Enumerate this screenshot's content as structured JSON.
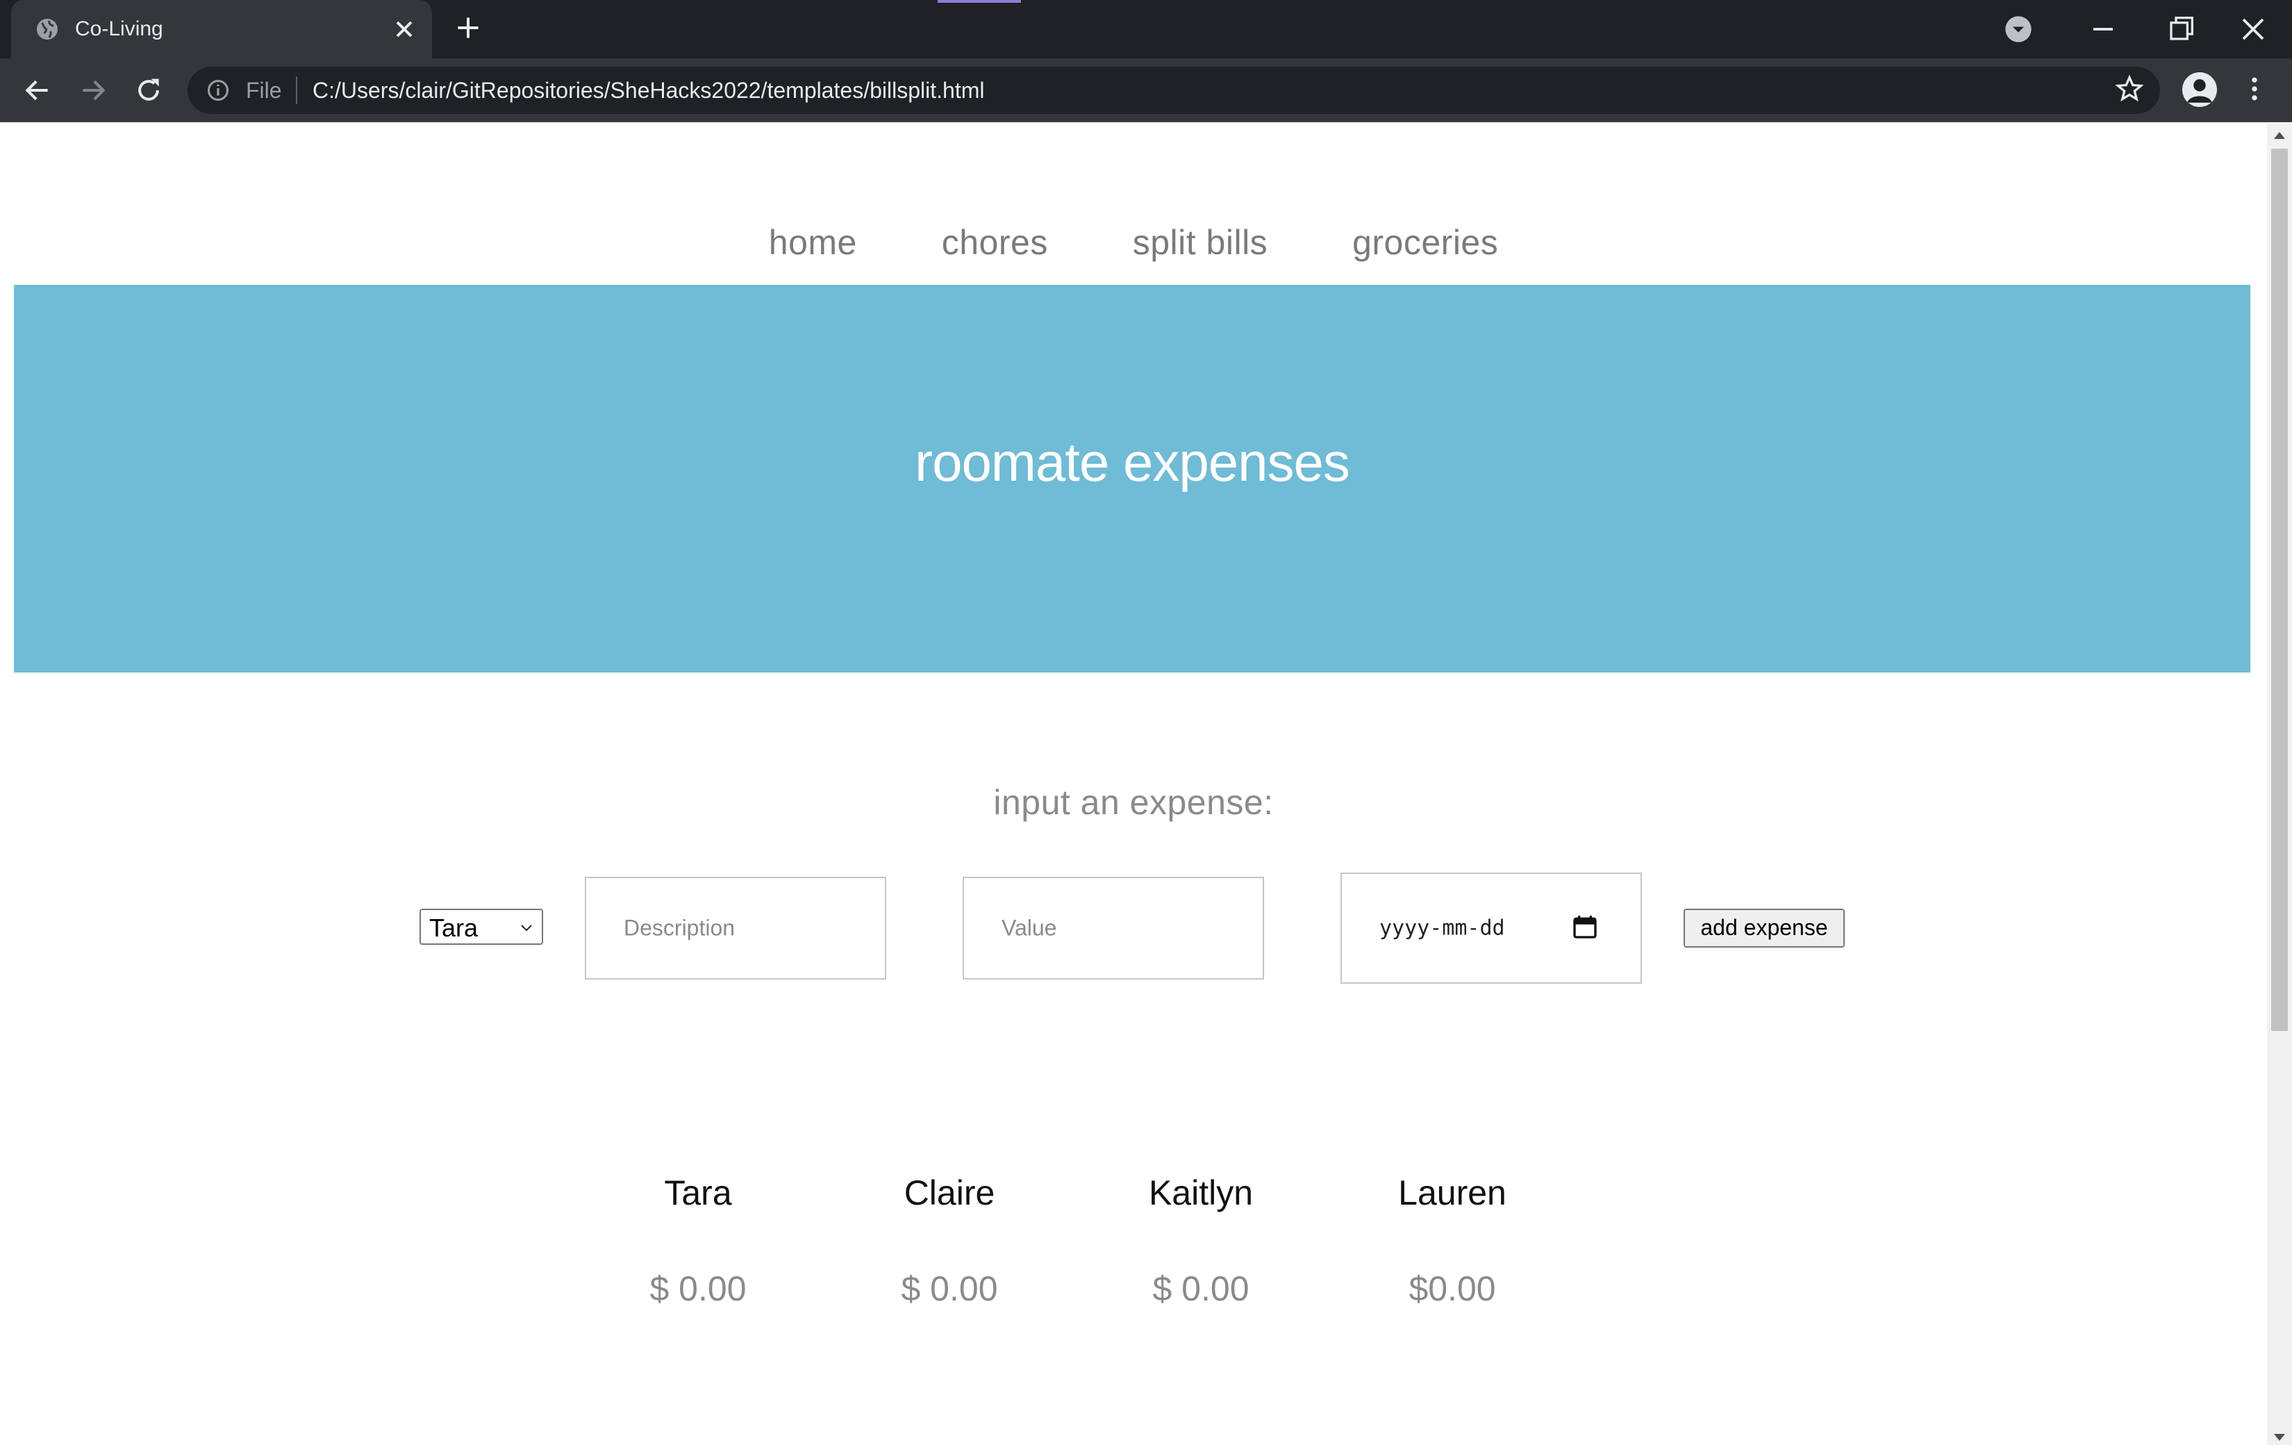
{
  "browser": {
    "tab_title": "Co-Living",
    "url_scheme": "File",
    "url": "C:/Users/clair/GitRepositories/SheHacks2022/templates/billsplit.html"
  },
  "nav": {
    "items": [
      "home",
      "chores",
      "split bills",
      "groceries"
    ]
  },
  "hero": {
    "title": "roomate expenses",
    "background_color": "#70bbd5"
  },
  "expense_form": {
    "heading": "input an expense:",
    "person_selected": "Tara",
    "description_placeholder": "Description",
    "value_placeholder": "Value",
    "date_placeholder": "yyyy-mm-dd",
    "submit_label": "add expense"
  },
  "roommates": [
    {
      "name": "Tara",
      "balance": "$ 0.00"
    },
    {
      "name": "Claire",
      "balance": "$ 0.00"
    },
    {
      "name": "Kaitlyn",
      "balance": "$ 0.00"
    },
    {
      "name": "Lauren",
      "balance": "$0.00"
    }
  ]
}
